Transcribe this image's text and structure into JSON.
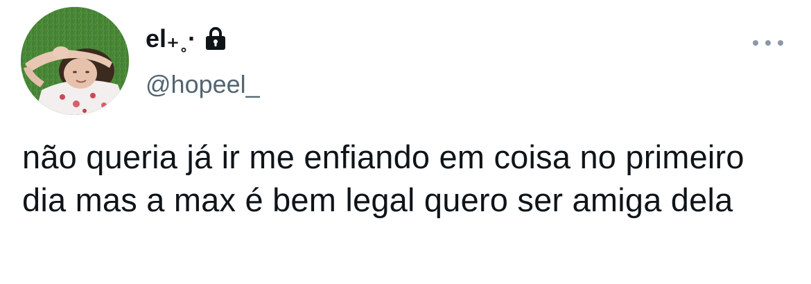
{
  "tweet": {
    "author": {
      "display_name": "el₊˳·",
      "handle": "@hopeel_",
      "avatar_icon": "profile-photo",
      "protected_icon": "lock-icon"
    },
    "more_icon": "more-horizontal-icon",
    "text": "não queria já ir me enfiando em coisa no primeiro dia mas a max é bem legal quero ser amiga dela"
  },
  "colors": {
    "text_primary": "#0f1419",
    "text_secondary": "#536471",
    "icon_gray": "#8b98a5",
    "background": "#ffffff"
  }
}
